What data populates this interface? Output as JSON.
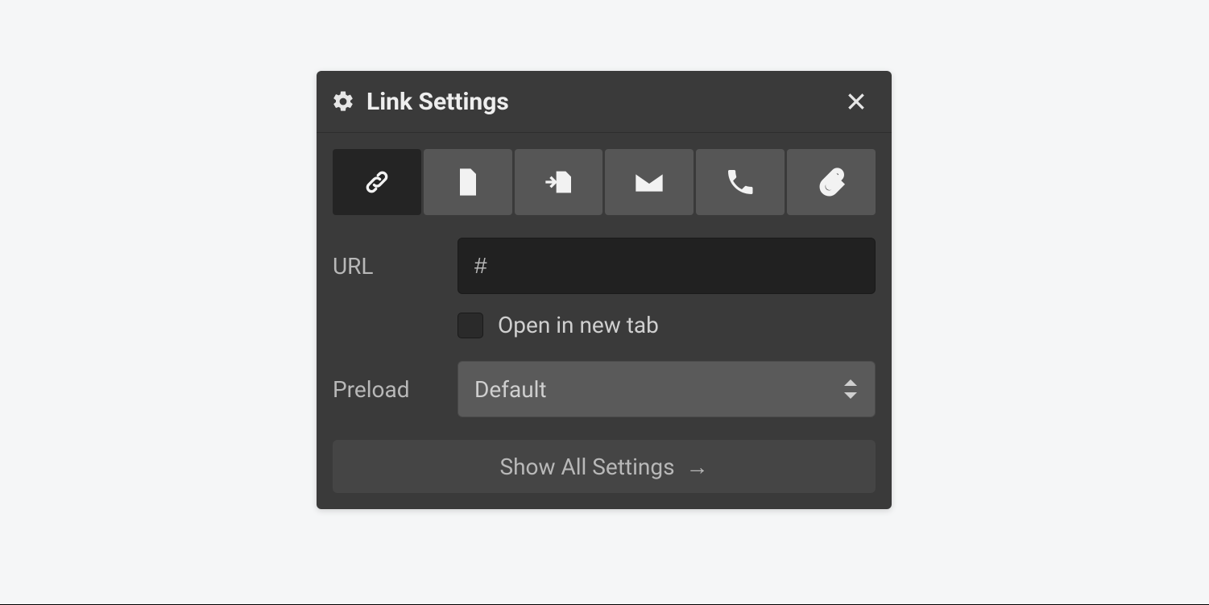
{
  "panel": {
    "title": "Link Settings"
  },
  "tabs": [
    {
      "name": "link",
      "active": true
    },
    {
      "name": "page",
      "active": false
    },
    {
      "name": "page-section",
      "active": false
    },
    {
      "name": "email",
      "active": false
    },
    {
      "name": "phone",
      "active": false
    },
    {
      "name": "file",
      "active": false
    }
  ],
  "fields": {
    "url_label": "URL",
    "url_value": "#",
    "open_new_tab_label": "Open in new tab",
    "open_new_tab_checked": false,
    "preload_label": "Preload",
    "preload_value": "Default"
  },
  "footer": {
    "show_all_label": "Show All Settings",
    "show_all_arrow": "→"
  }
}
